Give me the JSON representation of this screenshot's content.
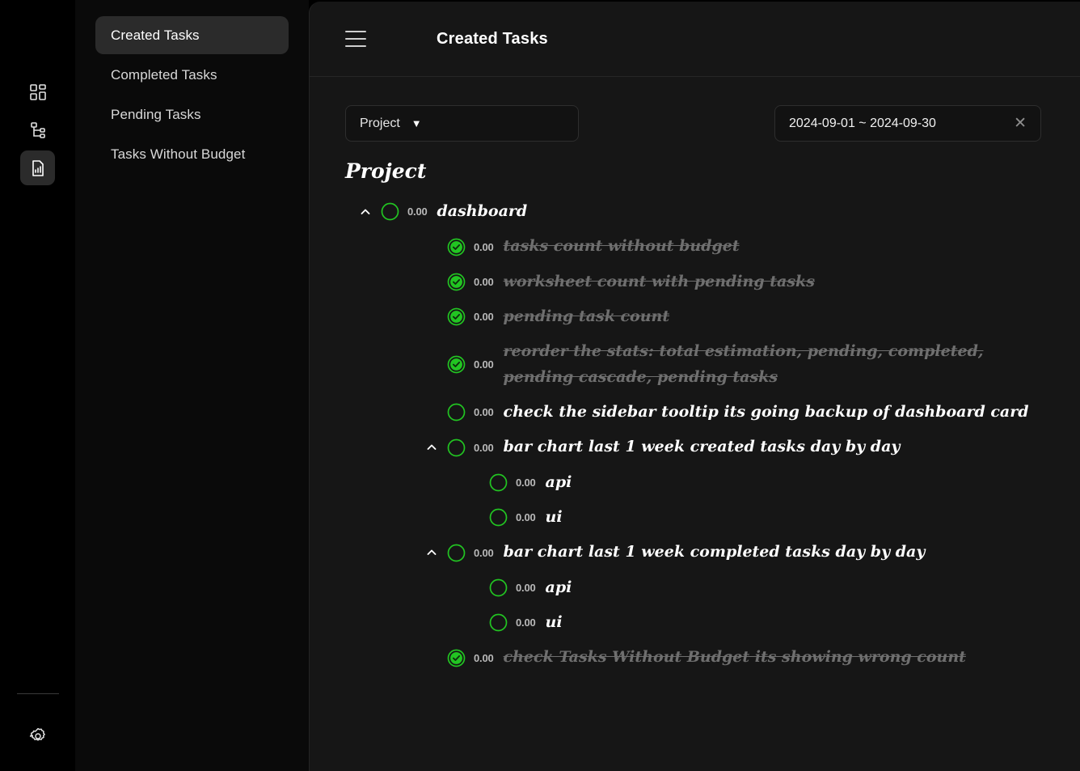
{
  "rail": {
    "icons": [
      {
        "name": "dashboard-grid-icon",
        "active": false
      },
      {
        "name": "hierarchy-tree-icon",
        "active": false
      },
      {
        "name": "report-document-icon",
        "active": true
      }
    ],
    "settings_label": "Settings"
  },
  "sidebar": {
    "items": [
      {
        "label": "Created Tasks",
        "active": true
      },
      {
        "label": "Completed Tasks",
        "active": false
      },
      {
        "label": "Pending Tasks",
        "active": false
      },
      {
        "label": "Tasks Without Budget",
        "active": false
      }
    ]
  },
  "topbar": {
    "title": "Created Tasks",
    "menu_icon": "hamburger-icon"
  },
  "filters": {
    "project_select": {
      "label": "Project",
      "caret": "▼"
    },
    "date_range": {
      "value": "2024-09-01 ~ 2024-09-30",
      "clear": "✕"
    }
  },
  "tree": {
    "title": "Project",
    "nodes": [
      {
        "level": 0,
        "amount": "0.00",
        "label": "dashboard",
        "checked": false,
        "expandable": true,
        "expanded": true,
        "wrapped": false
      },
      {
        "level": 1,
        "amount": "0.00",
        "label": "tasks count without budget",
        "checked": true,
        "expandable": false,
        "expanded": false,
        "wrapped": false
      },
      {
        "level": 1,
        "amount": "0.00",
        "label": "worksheet count with pending tasks",
        "checked": true,
        "expandable": false,
        "expanded": false,
        "wrapped": false
      },
      {
        "level": 1,
        "amount": "0.00",
        "label": "pending task count",
        "checked": true,
        "expandable": false,
        "expanded": false,
        "wrapped": false
      },
      {
        "level": 1,
        "amount": "0.00",
        "label": "reorder the stats: total estimation, pending, completed, pending cascade, pending tasks",
        "checked": true,
        "expandable": false,
        "expanded": false,
        "wrapped": true
      },
      {
        "level": 1,
        "amount": "0.00",
        "label": "check the sidebar tooltip its going backup of dashboard card",
        "checked": false,
        "expandable": false,
        "expanded": false,
        "wrapped": false
      },
      {
        "level": 1,
        "amount": "0.00",
        "label": "bar chart last 1 week created tasks day by day",
        "checked": false,
        "expandable": true,
        "expanded": true,
        "wrapped": false
      },
      {
        "level": 2,
        "amount": "0.00",
        "label": "api",
        "checked": false,
        "expandable": false,
        "expanded": false,
        "wrapped": false
      },
      {
        "level": 2,
        "amount": "0.00",
        "label": "ui",
        "checked": false,
        "expandable": false,
        "expanded": false,
        "wrapped": false
      },
      {
        "level": 1,
        "amount": "0.00",
        "label": "bar chart last 1 week completed tasks day by day",
        "checked": false,
        "expandable": true,
        "expanded": true,
        "wrapped": false
      },
      {
        "level": 2,
        "amount": "0.00",
        "label": "api",
        "checked": false,
        "expandable": false,
        "expanded": false,
        "wrapped": false
      },
      {
        "level": 2,
        "amount": "0.00",
        "label": "ui",
        "checked": false,
        "expandable": false,
        "expanded": false,
        "wrapped": false
      },
      {
        "level": 1,
        "amount": "0.00",
        "label": "check Tasks Without Budget its showing wrong count",
        "checked": true,
        "expandable": false,
        "expanded": false,
        "wrapped": false
      }
    ]
  },
  "colors": {
    "accent_green": "#22c522",
    "panel_bg": "#161616",
    "sidebar_bg": "#0a0a0a",
    "rail_bg": "#000000",
    "active_item_bg": "#2b2b2b",
    "done_text": "#6f6f6f"
  }
}
